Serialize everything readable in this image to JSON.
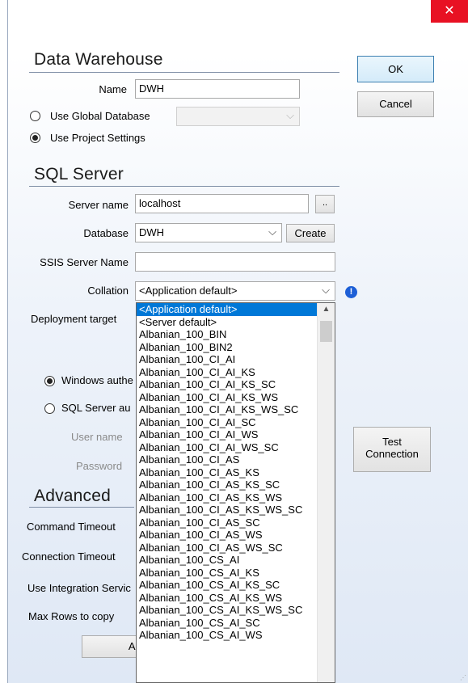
{
  "window": {
    "close_glyph": "✕"
  },
  "data_warehouse": {
    "title": "Data Warehouse",
    "name_label": "Name",
    "name_value": "DWH",
    "use_global_db_label": "Use Global Database",
    "global_db_value": "",
    "use_project_settings_label": "Use Project Settings"
  },
  "buttons": {
    "ok": "OK",
    "cancel": "Cancel",
    "test_line1": "Test",
    "test_line2": "Connection",
    "create": "Create",
    "browse": "..",
    "advanced_partial": "Ac"
  },
  "sql_server": {
    "title": "SQL Server",
    "server_name_label": "Server name",
    "server_name_value": "localhost",
    "database_label": "Database",
    "database_value": "DWH",
    "ssis_label": "SSIS Server Name",
    "ssis_value": "",
    "collation_label": "Collation",
    "collation_value": "<Application default>",
    "deployment_label": "Deployment target",
    "windows_auth_partial": "Windows authe",
    "sql_auth_partial": "SQL Server au",
    "username_label": "User name",
    "password_label": "Password"
  },
  "advanced": {
    "title": "Advanced",
    "command_timeout_label": "Command Timeout",
    "connection_timeout_label": "Connection Timeout",
    "use_integration_partial": "Use Integration Servic",
    "max_rows_label": "Max Rows to copy"
  },
  "collation_options": [
    "<Application default>",
    "<Server default>",
    "Albanian_100_BIN",
    "Albanian_100_BIN2",
    "Albanian_100_CI_AI",
    "Albanian_100_CI_AI_KS",
    "Albanian_100_CI_AI_KS_SC",
    "Albanian_100_CI_AI_KS_WS",
    "Albanian_100_CI_AI_KS_WS_SC",
    "Albanian_100_CI_AI_SC",
    "Albanian_100_CI_AI_WS",
    "Albanian_100_CI_AI_WS_SC",
    "Albanian_100_CI_AS",
    "Albanian_100_CI_AS_KS",
    "Albanian_100_CI_AS_KS_SC",
    "Albanian_100_CI_AS_KS_WS",
    "Albanian_100_CI_AS_KS_WS_SC",
    "Albanian_100_CI_AS_SC",
    "Albanian_100_CI_AS_WS",
    "Albanian_100_CI_AS_WS_SC",
    "Albanian_100_CS_AI",
    "Albanian_100_CS_AI_KS",
    "Albanian_100_CS_AI_KS_SC",
    "Albanian_100_CS_AI_KS_WS",
    "Albanian_100_CS_AI_KS_WS_SC",
    "Albanian_100_CS_AI_SC",
    "Albanian_100_CS_AI_WS"
  ],
  "colors": {
    "selection": "#0078d7",
    "close": "#e81123",
    "info": "#1d5fd6"
  }
}
